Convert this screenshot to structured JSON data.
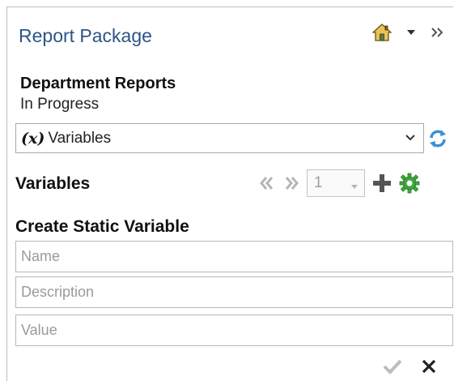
{
  "header": {
    "title": "Report Package",
    "home_icon": "home-icon",
    "menu_icon": "caret-down-icon",
    "collapse_icon": "double-chevron-right-icon"
  },
  "package": {
    "name": "Department Reports",
    "status": "In Progress"
  },
  "view_select": {
    "icon_glyph": "(x)",
    "selected": "Variables"
  },
  "variables": {
    "section_title": "Variables",
    "page_value": "1",
    "icons": [
      "prev-icon",
      "next-icon",
      "add-icon",
      "gear-icon"
    ]
  },
  "create_form": {
    "title": "Create Static Variable",
    "name_placeholder": "Name",
    "description_placeholder": "Description",
    "value_placeholder": "Value"
  },
  "colors": {
    "title_blue": "#2d5485",
    "refresh_blue": "#3d8fd6",
    "gear_green": "#3ea83e",
    "disabled_gray": "#b5b5b5"
  }
}
